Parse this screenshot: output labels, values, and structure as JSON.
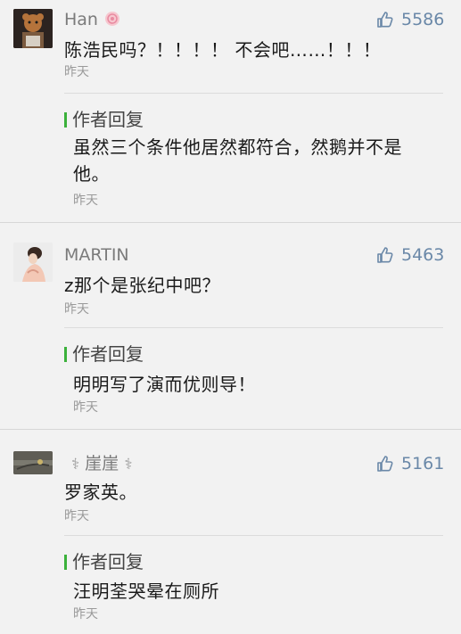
{
  "colors": {
    "background": "#f2f2f2",
    "reply_accent": "#3bb13b",
    "like_color": "#6a88a8"
  },
  "comments": [
    {
      "username": "Han",
      "username_emoji": "flower-emoji",
      "likes": "5586",
      "text": "陈浩民吗？！！！！ 不会吧……！！！",
      "time": "昨天",
      "reply": {
        "label": "作者回复",
        "text_line1": "虽然三个条件他居然都符合，然鹅并不是",
        "text_line2": "他。",
        "time": "昨天"
      }
    },
    {
      "username": "MARTIN",
      "likes": "5463",
      "text": "z那个是张纪中吧？",
      "time": "昨天",
      "reply": {
        "label": "作者回复",
        "text_line1": "明明写了演而优则导！",
        "time": "昨天"
      }
    },
    {
      "username": "崖崖",
      "username_emoji": "caduceus-symbol",
      "likes": "5161",
      "text": "罗家英。",
      "time": "昨天",
      "reply": {
        "label": "作者回复",
        "text_line1": "汪明荃哭晕在厕所",
        "time": "昨天"
      }
    }
  ]
}
